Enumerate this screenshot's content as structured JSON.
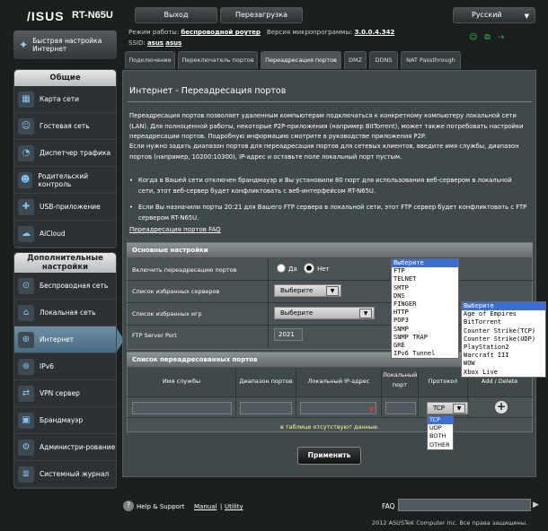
{
  "header": {
    "brand": "/ISUS",
    "model": "RT-N65U",
    "logout": "Выход",
    "reboot": "Перезагрузка",
    "language": "Русский",
    "mode_label": "Режим работы:",
    "mode_value": "беспроводной роутер",
    "firmware_label": "Версия микропрограммы:",
    "firmware_value": "3.0.0.4.342",
    "ssid_label": "SSID:",
    "ssid1": "asus",
    "ssid2": "asus"
  },
  "sidebar": {
    "qis": "Быстрая настройка Интернет",
    "general_title": "Общие",
    "general": [
      {
        "label": "Карта сети",
        "icon": "network-map-icon",
        "glyph": "▦"
      },
      {
        "label": "Гостевая сеть",
        "icon": "guest-network-icon",
        "glyph": "☺"
      },
      {
        "label": "Диспетчер трафика",
        "icon": "traffic-manager-icon",
        "glyph": "◔"
      },
      {
        "label": "Родительский контроль",
        "icon": "parental-control-icon",
        "glyph": "☻"
      },
      {
        "label": "USB-приложение",
        "icon": "usb-app-icon",
        "glyph": "✚"
      },
      {
        "label": "AiCloud",
        "icon": "aicloud-icon",
        "glyph": "☁"
      }
    ],
    "advanced_title": "Дополнительные настройки",
    "advanced": [
      {
        "label": "Беспроводная сеть",
        "icon": "wireless-icon",
        "glyph": "⊙"
      },
      {
        "label": "Локальная сеть",
        "icon": "lan-icon",
        "glyph": "⌂"
      },
      {
        "label": "Интернет",
        "icon": "internet-icon",
        "glyph": "⊕"
      },
      {
        "label": "IPv6",
        "icon": "ipv6-icon",
        "glyph": "⊛"
      },
      {
        "label": "VPN сервер",
        "icon": "vpn-icon",
        "glyph": "⇄"
      },
      {
        "label": "Брандмауэр",
        "icon": "firewall-icon",
        "glyph": "▣"
      },
      {
        "label": "Администри-рование",
        "icon": "admin-icon",
        "glyph": "⚙"
      },
      {
        "label": "Системный журнал",
        "icon": "syslog-icon",
        "glyph": "≣"
      }
    ]
  },
  "tabs": [
    "Подключение",
    "Переключатель портов",
    "Переадресация портов",
    "DMZ",
    "DDNS",
    "NAT Passthrough"
  ],
  "main": {
    "title": "Интернет - Переадресация портов",
    "p1": "Переадресация портов позволяет удаленным компьютерам подключаться к конкретному компьютеру локальной сети (LAN). Для полноценной работы, некоторые P2P-приложения (например BitTorrent), может также потребовать настройки переадресации портов. Подробную информацию смотрите в руководстве приложения P2P.",
    "p2": "Если нужно задать диапазон портов для переадресации портов для сетевых клиентов, введите имя службы, диапазон портов (например, 10200:10300), IP-адрес и оставьте поле локальный порт пустым.",
    "b1": "Когда в Вашей сети отключен брандмауэр и Вы установили 80 порт для использования веб-сервером в локальной сети, этот веб-сервер будет конфликтовать с веб-интерфейсом RT-N65U.",
    "b2": "Если Вы назначили порты 20:21 для Вашего FTP сервера в локальной сети, этот FTP сервер будет конфликтовать с FTP сервером RT-N65U.",
    "faq": "Переадресация портов FAQ",
    "basic_title": "Основные настройки",
    "enable_label": "Включить переадресацию портов",
    "yes": "Да",
    "no": "Нет",
    "servers_label": "Список избранных серверов",
    "servers_value": "Выберите",
    "games_label": "Список избранных игр",
    "games_value": "Выберите",
    "ftp_label": "FTP Server Port",
    "ftp_value": "2021",
    "server_options": [
      "Выберите",
      "FTP",
      "TELNET",
      "SMTP",
      "DNS",
      "FINGER",
      "HTTP",
      "POP3",
      "SNMP",
      "SNMP TRAP",
      "GRE",
      "IPv6 Tunnel"
    ],
    "game_options": [
      "Выберите",
      "Age of Empires",
      "BitTorrent",
      "Counter Strike(TCP)",
      "Counter Strike(UDP)",
      "PlayStation2",
      "Warcraft III",
      "WOW",
      "Xbox Live"
    ],
    "list_title": "Список переадресованных портов",
    "cols": [
      "Имя службы",
      "Диапазон портов",
      "Локальный IP-адрес",
      "Локальный порт",
      "Протокол",
      "Add / Delete"
    ],
    "protocol_value": "TCP",
    "protocol_options": [
      "TCP",
      "UDP",
      "BOTH",
      "OTHER"
    ],
    "empty_msg": "в таблице отсутствуют данные.",
    "apply": "Применить"
  },
  "footer": {
    "help": "Help & Support",
    "manual": "Manual",
    "sep": "|",
    "utility": "Utility",
    "faq": "FAQ",
    "copyright": "2012 ASUSTeK Computer Inc. Все права защищены."
  }
}
